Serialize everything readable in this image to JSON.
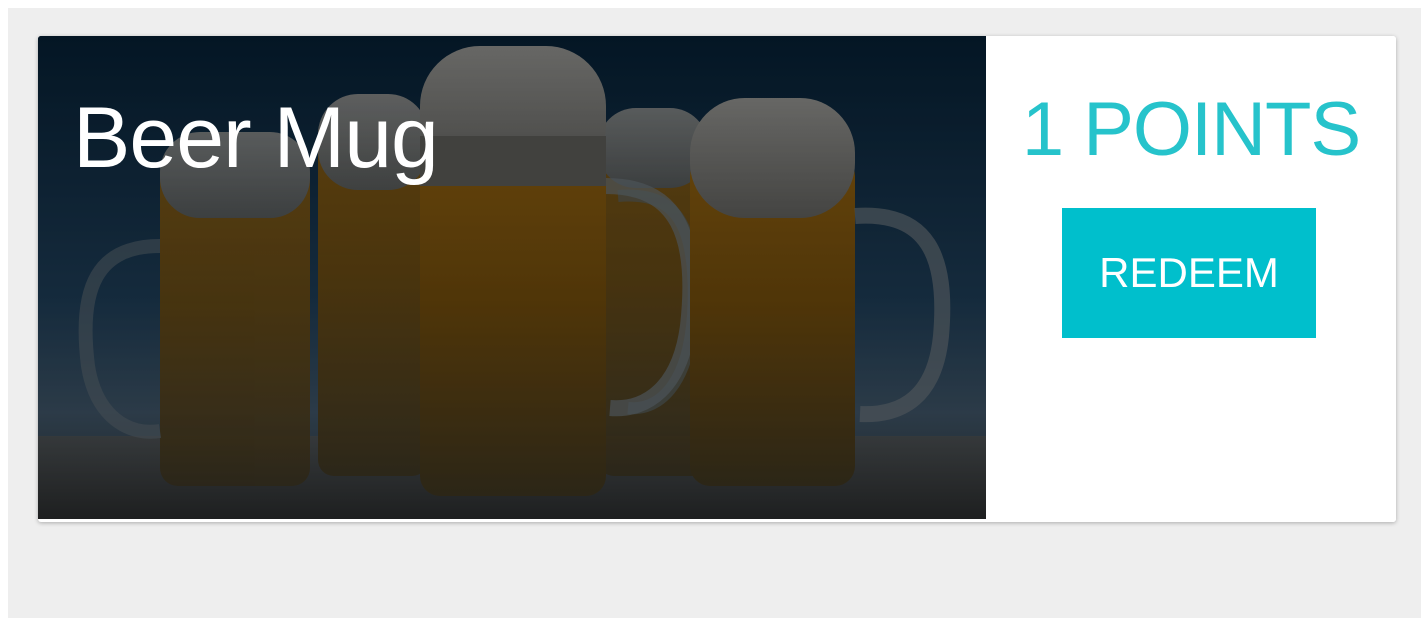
{
  "reward": {
    "title": "Beer Mug",
    "points": "1 POINTS",
    "redeem_label": "REDEEM",
    "image_icon": "beer-mugs-photo"
  },
  "colors": {
    "page_background": "#eeeeee",
    "card_background": "#ffffff",
    "accent": "#00bfcc",
    "points_text": "#26c3cb"
  }
}
